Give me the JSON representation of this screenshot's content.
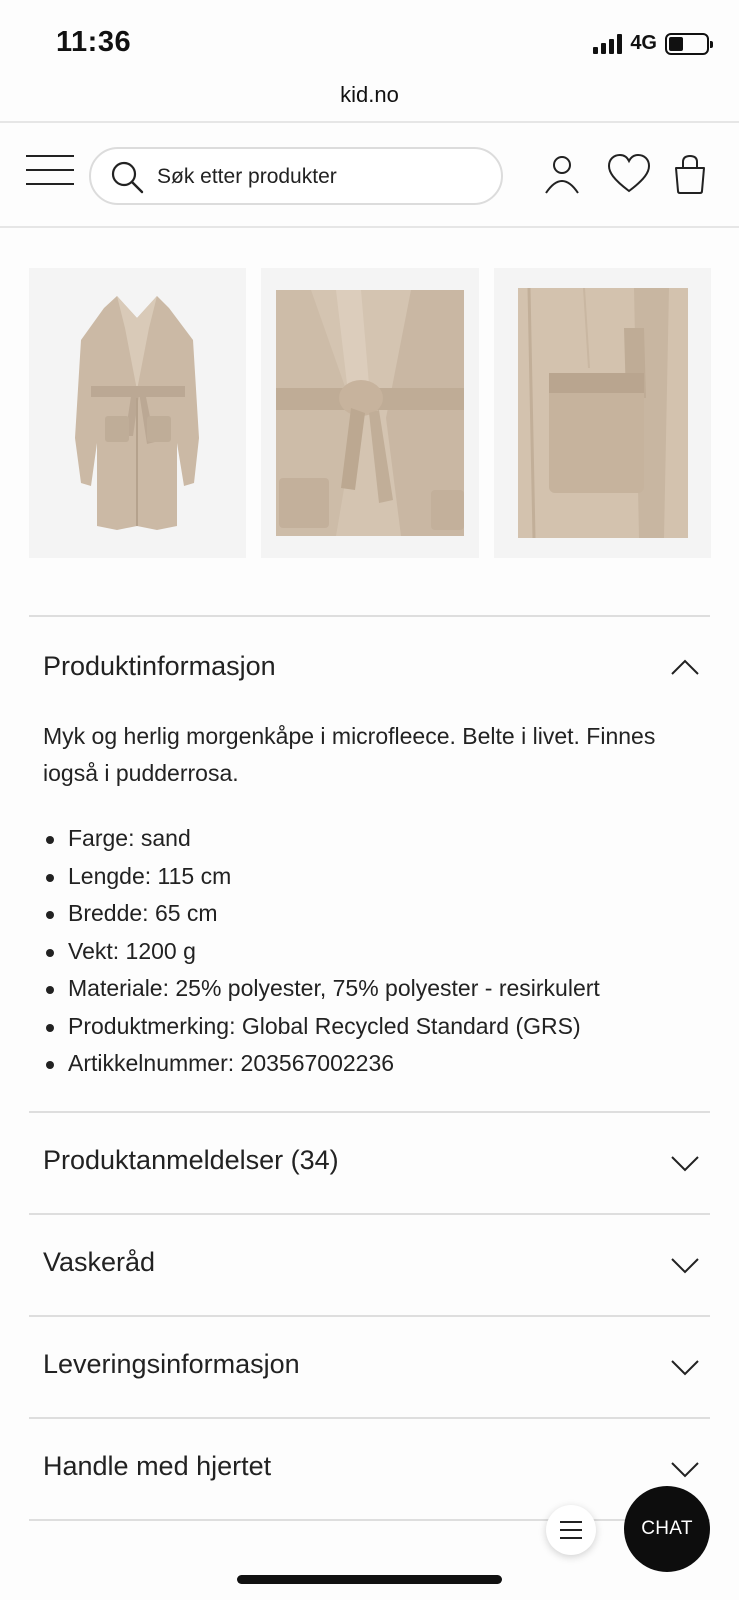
{
  "status_bar": {
    "time": "11:36",
    "network": "4G"
  },
  "browser": {
    "url": "kid.no"
  },
  "header": {
    "search_placeholder": "Søk etter produkter"
  },
  "product_info": {
    "title": "Produktinformasjon",
    "description": "Myk og herlig morgenkåpe i microfleece. Belte i livet. Finnes iogså i pudderrosa.",
    "specs": [
      "Farge: sand",
      "Lengde: 115 cm",
      "Bredde: 65 cm",
      "Vekt: 1200 g",
      "Materiale: 25% polyester, 75% polyester - resirkulert",
      "Produktmerking: Global Recycled Standard (GRS)",
      "Artikkelnummer: 203567002236"
    ]
  },
  "sections": [
    {
      "title": "Produktanmeldelser (34)"
    },
    {
      "title": "Vaskeråd"
    },
    {
      "title": "Leveringsinformasjon"
    },
    {
      "title": "Handle med hjertet"
    }
  ],
  "chat": {
    "label": "CHAT"
  },
  "colors": {
    "robe_sand": "#cbb9a5",
    "thumb_bg": "#f4f4f4",
    "chat_bg": "#0d0d0d"
  }
}
